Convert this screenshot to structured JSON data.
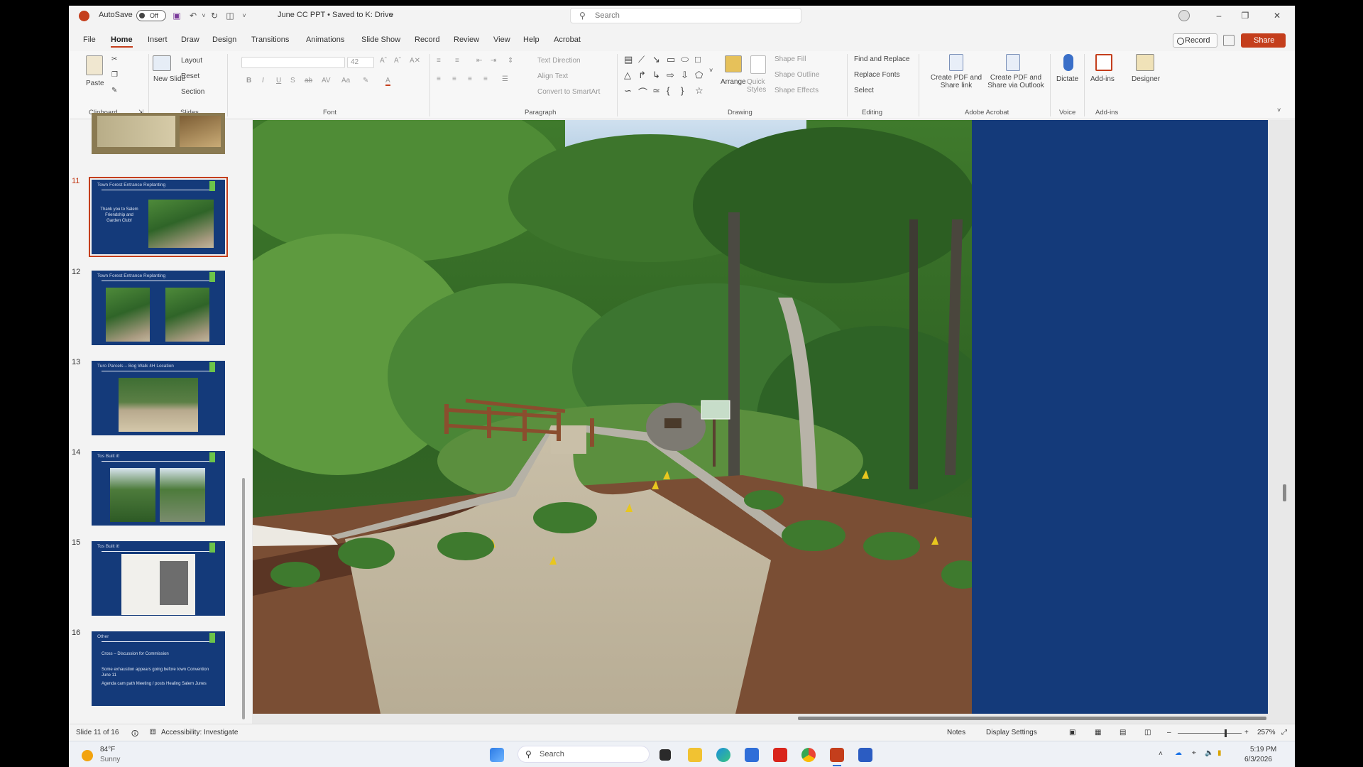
{
  "titlebar": {
    "autosave_label": "AutoSave",
    "autosave_state": "Off",
    "doc_title": "June CC PPT • Saved to K: Drive",
    "search_placeholder": "Search"
  },
  "menu": {
    "tabs": [
      "File",
      "Home",
      "Insert",
      "Draw",
      "Design",
      "Transitions",
      "Animations",
      "Slide Show",
      "Record",
      "Review",
      "View",
      "Help",
      "Acrobat"
    ],
    "active": "Home",
    "record_label": "Record",
    "share_label": "Share"
  },
  "ribbon": {
    "clipboard": {
      "paste": "Paste",
      "group": "Clipboard"
    },
    "slides": {
      "new_slide": "New Slide",
      "layout": "Layout",
      "reset": "Reset",
      "section": "Section",
      "group": "Slides"
    },
    "font": {
      "size": "42",
      "group": "Font"
    },
    "paragraph": {
      "text_direction": "Text Direction",
      "align_text": "Align Text",
      "convert_smartart": "Convert to SmartArt",
      "group": "Paragraph"
    },
    "drawing": {
      "arrange": "Arrange",
      "quick_styles": "Quick Styles",
      "shape_fill": "Shape Fill",
      "shape_outline": "Shape Outline",
      "shape_effects": "Shape Effects",
      "group": "Drawing"
    },
    "editing": {
      "find_replace": "Find and Replace",
      "replace_fonts": "Replace Fonts",
      "select": "Select",
      "group": "Editing"
    },
    "acrobat": {
      "create_pdf_share": "Create PDF and Share link",
      "create_pdf_outlook": "Create PDF and Share via Outlook",
      "group": "Adobe Acrobat"
    },
    "voice": {
      "dictate": "Dictate",
      "group": "Voice"
    },
    "addins": {
      "addins": "Add-ins",
      "designer": "Designer",
      "group": "Add-ins"
    }
  },
  "slides_panel": {
    "thumbnails": [
      {
        "number": "11",
        "title": "Town Forest Entrance Replanting",
        "body": "Thank you to Salem Friendship and Garden Club!",
        "selected": true
      },
      {
        "number": "12",
        "title": "Town Forest Entrance Replanting",
        "body": "",
        "selected": false
      },
      {
        "number": "13",
        "title": "Turo Parcels – Bog Walk 4H Location",
        "body": "",
        "selected": false
      },
      {
        "number": "14",
        "title": "Tos Built it!",
        "body": "",
        "selected": false
      },
      {
        "number": "15",
        "title": "Tos Built it!",
        "body": "",
        "selected": false
      },
      {
        "number": "16",
        "title": "Other",
        "body": "Cross – Discussion for Commission",
        "body2": "Some exhaustion appears going before town Convention June 11",
        "body3": "Agenda cam path Meeting / posts Healing Salem Junes",
        "selected": false
      }
    ]
  },
  "statusbar": {
    "slide_indicator": "Slide 11 of 16",
    "accessibility": "Accessibility: Investigate",
    "notes": "Notes",
    "display_settings": "Display Settings",
    "zoom": "257%"
  },
  "taskbar": {
    "weather_temp": "84°F",
    "weather_desc": "Sunny",
    "search_label": "Search",
    "time": "5:19 PM",
    "date": "6/3/2026"
  },
  "colors": {
    "accent": "#c43e1c",
    "slide_blue": "#143a7a",
    "label_green": "#6cc44a"
  }
}
